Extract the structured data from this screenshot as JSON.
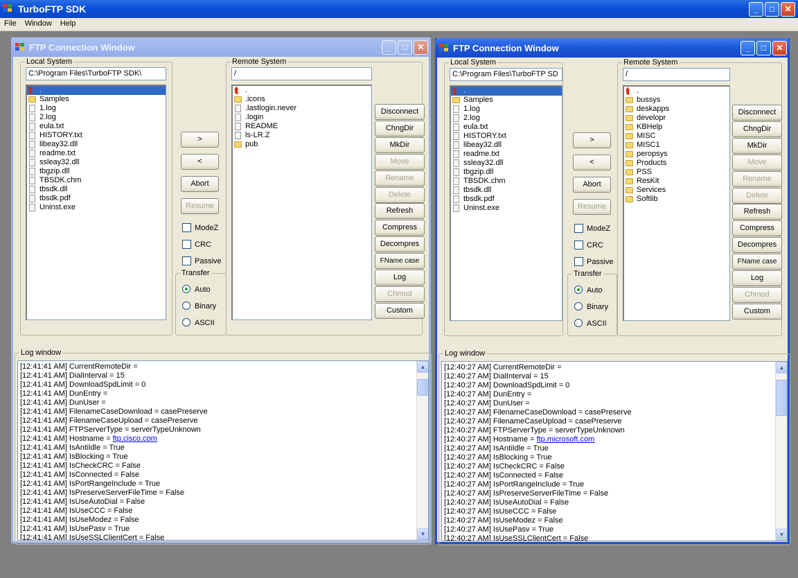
{
  "app": {
    "title": "TurboFTP SDK"
  },
  "menu": [
    "File",
    "Window",
    "Help"
  ],
  "windows": [
    {
      "title": "FTP Connection Window",
      "local_legend": "Local System",
      "local_path": "C:\\Program Files\\TurboFTP SDK\\",
      "local_files": [
        {
          "name": ".",
          "kind": "up",
          "selected": true
        },
        {
          "name": "Samples",
          "kind": "folder"
        },
        {
          "name": "1.log",
          "kind": "file"
        },
        {
          "name": "2.log",
          "kind": "file"
        },
        {
          "name": "eula.txt",
          "kind": "file"
        },
        {
          "name": "HISTORY.txt",
          "kind": "file"
        },
        {
          "name": "libeay32.dll",
          "kind": "file"
        },
        {
          "name": "readme.txt",
          "kind": "file"
        },
        {
          "name": "ssleay32.dll",
          "kind": "file"
        },
        {
          "name": "tbgzip.dll",
          "kind": "file"
        },
        {
          "name": "TBSDK.chm",
          "kind": "file"
        },
        {
          "name": "tbsdk.dll",
          "kind": "file"
        },
        {
          "name": "tbsdk.pdf",
          "kind": "file"
        },
        {
          "name": "Uninst.exe",
          "kind": "file"
        }
      ],
      "remote_legend": "Remote System",
      "remote_path": "/",
      "remote_files": [
        {
          "name": ".",
          "kind": "up"
        },
        {
          "name": ".icons",
          "kind": "folder"
        },
        {
          "name": ".lastlogin.never",
          "kind": "file"
        },
        {
          "name": ".login",
          "kind": "file"
        },
        {
          "name": "README",
          "kind": "file"
        },
        {
          "name": "ls-LR.Z",
          "kind": "file"
        },
        {
          "name": "pub",
          "kind": "folder"
        }
      ],
      "log_lines": [
        {
          "time": "[12:41:41 AM]",
          "text": "CurrentRemoteDir  ="
        },
        {
          "time": "[12:41:41 AM]",
          "text": "DialInterval  = 15"
        },
        {
          "time": "[12:41:41 AM]",
          "text": "DownloadSpdLimit  = 0"
        },
        {
          "time": "[12:41:41 AM]",
          "text": "DunEntry  ="
        },
        {
          "time": "[12:41:41 AM]",
          "text": "DunUser  ="
        },
        {
          "time": "[12:41:41 AM]",
          "text": "FilenameCaseDownload  = casePreserve"
        },
        {
          "time": "[12:41:41 AM]",
          "text": "FilenameCaseUpload  = casePreserve"
        },
        {
          "time": "[12:41:41 AM]",
          "text": "FTPServerType  = serverTypeUnknown"
        },
        {
          "time": "[12:41:41 AM]",
          "text": "Hostname  = ",
          "link": "ftp.cisco.com"
        },
        {
          "time": "[12:41:41 AM]",
          "text": "IsAntiIdle  = True"
        },
        {
          "time": "[12:41:41 AM]",
          "text": "IsBlocking  = True"
        },
        {
          "time": "[12:41:41 AM]",
          "text": "IsCheckCRC  = False"
        },
        {
          "time": "[12:41:41 AM]",
          "text": "IsConnected  = False"
        },
        {
          "time": "[12:41:41 AM]",
          "text": "IsPortRangeInclude  = True"
        },
        {
          "time": "[12:41:41 AM]",
          "text": "IsPreserveServerFileTime  = False"
        },
        {
          "time": "[12:41:41 AM]",
          "text": "IsUseAutoDial  = False"
        },
        {
          "time": "[12:41:41 AM]",
          "text": "IsUseCCC  = False"
        },
        {
          "time": "[12:41:41 AM]",
          "text": "IsUseModez  = False"
        },
        {
          "time": "[12:41:41 AM]",
          "text": "IsUsePasv  = True"
        },
        {
          "time": "[12:41:41 AM]",
          "text": "IsUseSSLClientCert  = False"
        }
      ]
    },
    {
      "title": "FTP Connection Window",
      "local_legend": "Local System",
      "local_path": "C:\\Program Files\\TurboFTP SD",
      "local_files": [
        {
          "name": ".",
          "kind": "up",
          "selected": true
        },
        {
          "name": "Samples",
          "kind": "folder"
        },
        {
          "name": "1.log",
          "kind": "file"
        },
        {
          "name": "2.log",
          "kind": "file"
        },
        {
          "name": "eula.txt",
          "kind": "file"
        },
        {
          "name": "HISTORY.txt",
          "kind": "file"
        },
        {
          "name": "libeay32.dll",
          "kind": "file"
        },
        {
          "name": "readme.txt",
          "kind": "file"
        },
        {
          "name": "ssleay32.dll",
          "kind": "file"
        },
        {
          "name": "tbgzip.dll",
          "kind": "file"
        },
        {
          "name": "TBSDK.chm",
          "kind": "file"
        },
        {
          "name": "tbsdk.dll",
          "kind": "file"
        },
        {
          "name": "tbsdk.pdf",
          "kind": "file"
        },
        {
          "name": "Uninst.exe",
          "kind": "file"
        }
      ],
      "remote_legend": "Remote System",
      "remote_path": "/",
      "remote_files": [
        {
          "name": ".",
          "kind": "up"
        },
        {
          "name": "bussys",
          "kind": "folder"
        },
        {
          "name": "deskapps",
          "kind": "folder"
        },
        {
          "name": "developr",
          "kind": "folder"
        },
        {
          "name": "KBHelp",
          "kind": "folder"
        },
        {
          "name": "MISC",
          "kind": "folder"
        },
        {
          "name": "MISC1",
          "kind": "folder"
        },
        {
          "name": "peropsys",
          "kind": "folder"
        },
        {
          "name": "Products",
          "kind": "folder"
        },
        {
          "name": "PSS",
          "kind": "folder"
        },
        {
          "name": "ResKit",
          "kind": "folder"
        },
        {
          "name": "Services",
          "kind": "folder"
        },
        {
          "name": "Softlib",
          "kind": "folder"
        }
      ],
      "log_lines": [
        {
          "time": "[12:40:27 AM]",
          "text": "CurrentRemoteDir  ="
        },
        {
          "time": "[12:40:27 AM]",
          "text": "DialInterval  = 15"
        },
        {
          "time": "[12:40:27 AM]",
          "text": "DownloadSpdLimit  = 0"
        },
        {
          "time": "[12:40:27 AM]",
          "text": "DunEntry  ="
        },
        {
          "time": "[12:40:27 AM]",
          "text": "DunUser  ="
        },
        {
          "time": "[12:40:27 AM]",
          "text": "FilenameCaseDownload  = casePreserve"
        },
        {
          "time": "[12:40:27 AM]",
          "text": "FilenameCaseUpload  = casePreserve"
        },
        {
          "time": "[12:40:27 AM]",
          "text": "FTPServerType  = serverTypeUnknown"
        },
        {
          "time": "[12:40:27 AM]",
          "text": "Hostname  = ",
          "link": "ftp.microsoft.com"
        },
        {
          "time": "[12:40:27 AM]",
          "text": "IsAntiIdle  = True"
        },
        {
          "time": "[12:40:27 AM]",
          "text": "IsBlocking  = True"
        },
        {
          "time": "[12:40:27 AM]",
          "text": "IsCheckCRC  = False"
        },
        {
          "time": "[12:40:27 AM]",
          "text": "IsConnected  = False"
        },
        {
          "time": "[12:40:27 AM]",
          "text": "IsPortRangeInclude  = True"
        },
        {
          "time": "[12:40:27 AM]",
          "text": "IsPreserveServerFileTime  = False"
        },
        {
          "time": "[12:40:27 AM]",
          "text": "IsUseAutoDial  = False"
        },
        {
          "time": "[12:40:27 AM]",
          "text": "IsUseCCC  = False"
        },
        {
          "time": "[12:40:27 AM]",
          "text": "IsUseModez  = False"
        },
        {
          "time": "[12:40:27 AM]",
          "text": "IsUsePasv  = True"
        },
        {
          "time": "[12:40:27 AM]",
          "text": "IsUseSSLClientCert  = False"
        }
      ]
    }
  ],
  "transfer_controls": {
    "upload_label": ">",
    "download_label": "<",
    "abort_label": "Abort",
    "resume_label": "Resume",
    "modez_label": "ModeZ",
    "crc_label": "CRC",
    "passive_label": "Passive",
    "transfer_legend": "Transfer",
    "auto_label": "Auto",
    "binary_label": "Binary",
    "ascii_label": "ASCII",
    "selected_mode": "Auto"
  },
  "remote_buttons": [
    {
      "label": "Disconnect",
      "enabled": true
    },
    {
      "label": "ChngDir",
      "enabled": true
    },
    {
      "label": "MkDir",
      "enabled": true
    },
    {
      "label": "Move",
      "enabled": false
    },
    {
      "label": "Rename",
      "enabled": false
    },
    {
      "label": "Delete",
      "enabled": false
    },
    {
      "label": "Refresh",
      "enabled": true
    },
    {
      "label": "Compress",
      "enabled": true
    },
    {
      "label": "Decompres",
      "enabled": true
    },
    {
      "label": "FName case",
      "enabled": true
    },
    {
      "label": "Log",
      "enabled": true
    },
    {
      "label": "Chmod",
      "enabled": false
    },
    {
      "label": "Custom",
      "enabled": true
    }
  ],
  "log_legend": "Log window",
  "window_controls": {
    "minimize": "_",
    "maximize": "□",
    "close": "✕"
  },
  "icons": {
    "app": "turboftp-app-icon",
    "up": "up-arrow-icon",
    "folder": "folder-icon",
    "file": "file-icon"
  }
}
